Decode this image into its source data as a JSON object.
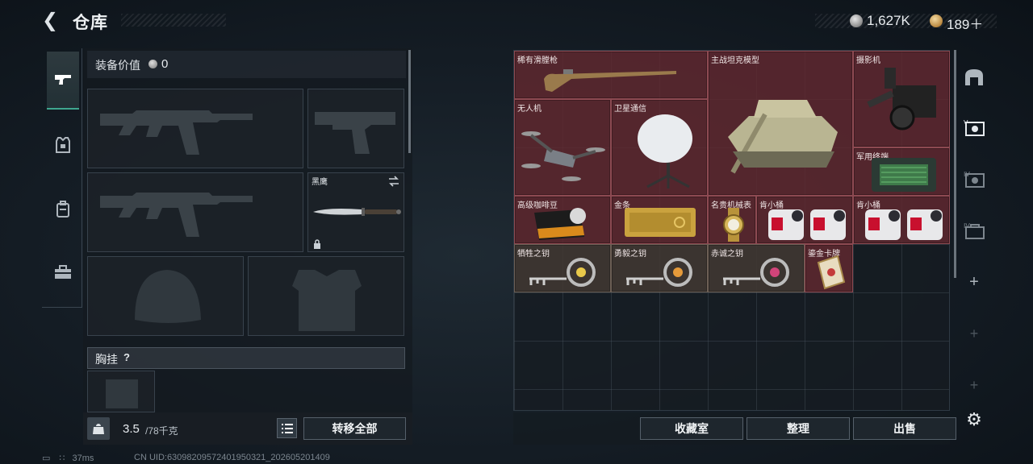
{
  "header": {
    "title": "仓库",
    "silver": "1,627K",
    "gold": "189＋"
  },
  "equipment": {
    "label": "装备价值",
    "value": "0",
    "knife_name": "黑鹰",
    "chest_label": "胸挂",
    "chest_help": "?"
  },
  "weight": {
    "current": "3.5",
    "max": "/78千克"
  },
  "buttons": {
    "transfer_all": "转移全部",
    "collection": "收藏室",
    "sort": "整理",
    "sell": "出售"
  },
  "storage_items": [
    {
      "name": "稀有滑膛枪"
    },
    {
      "name": "主战坦克模型"
    },
    {
      "name": "摄影机"
    },
    {
      "name": "无人机"
    },
    {
      "name": "卫星通信"
    },
    {
      "name": "军用终端"
    },
    {
      "name": "高级咖啡豆"
    },
    {
      "name": "金条"
    },
    {
      "name": "名贵机械表"
    },
    {
      "name": "肯小桶"
    },
    {
      "name": "肯小桶"
    },
    {
      "name": "牺牲之钥"
    },
    {
      "name": "勇毅之钥"
    },
    {
      "name": "赤诚之钥"
    },
    {
      "name": "鎏金卡牌"
    }
  ],
  "status": {
    "ping": "37ms",
    "uid": "CN UID:6309820957240195032​1_202605201409"
  },
  "colors": {
    "rare_red": "#622830",
    "accent": "#3fa78f"
  }
}
